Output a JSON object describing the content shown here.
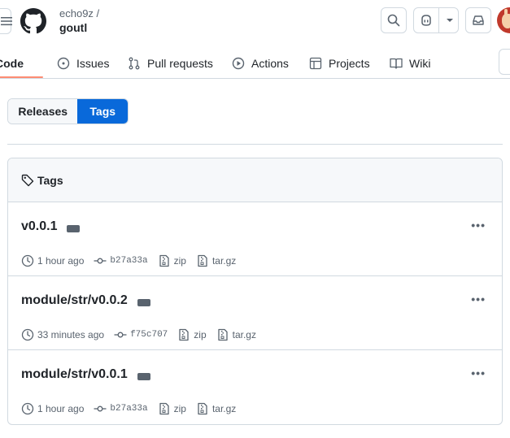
{
  "header": {
    "owner": "echo9z /",
    "repo": "goutl"
  },
  "nav": {
    "tabs": [
      {
        "label": "Code",
        "icon": "code-icon",
        "active": true
      },
      {
        "label": "Issues",
        "icon": "issue-icon",
        "active": false
      },
      {
        "label": "Pull requests",
        "icon": "pull-request-icon",
        "active": false
      },
      {
        "label": "Actions",
        "icon": "play-icon",
        "active": false
      },
      {
        "label": "Projects",
        "icon": "table-icon",
        "active": false
      },
      {
        "label": "Wiki",
        "icon": "book-icon",
        "active": false
      }
    ]
  },
  "toggle": {
    "releases": "Releases",
    "tags": "Tags",
    "selected": "Tags"
  },
  "tags_box": {
    "title": "Tags",
    "rows": [
      {
        "name": "v0.0.1",
        "time": "1 hour ago",
        "sha": "b27a33a",
        "zip": "zip",
        "targz": "tar.gz"
      },
      {
        "name": "module/str/v0.0.2",
        "time": "33 minutes ago",
        "sha": "f75c707",
        "zip": "zip",
        "targz": "tar.gz"
      },
      {
        "name": "module/str/v0.0.1",
        "time": "1 hour ago",
        "sha": "b27a33a",
        "zip": "zip",
        "targz": "tar.gz"
      }
    ]
  },
  "colors": {
    "accent": "#0969da",
    "tab_underline": "#fd8c73",
    "border": "#d1d9e0",
    "muted_text": "#59636e"
  }
}
